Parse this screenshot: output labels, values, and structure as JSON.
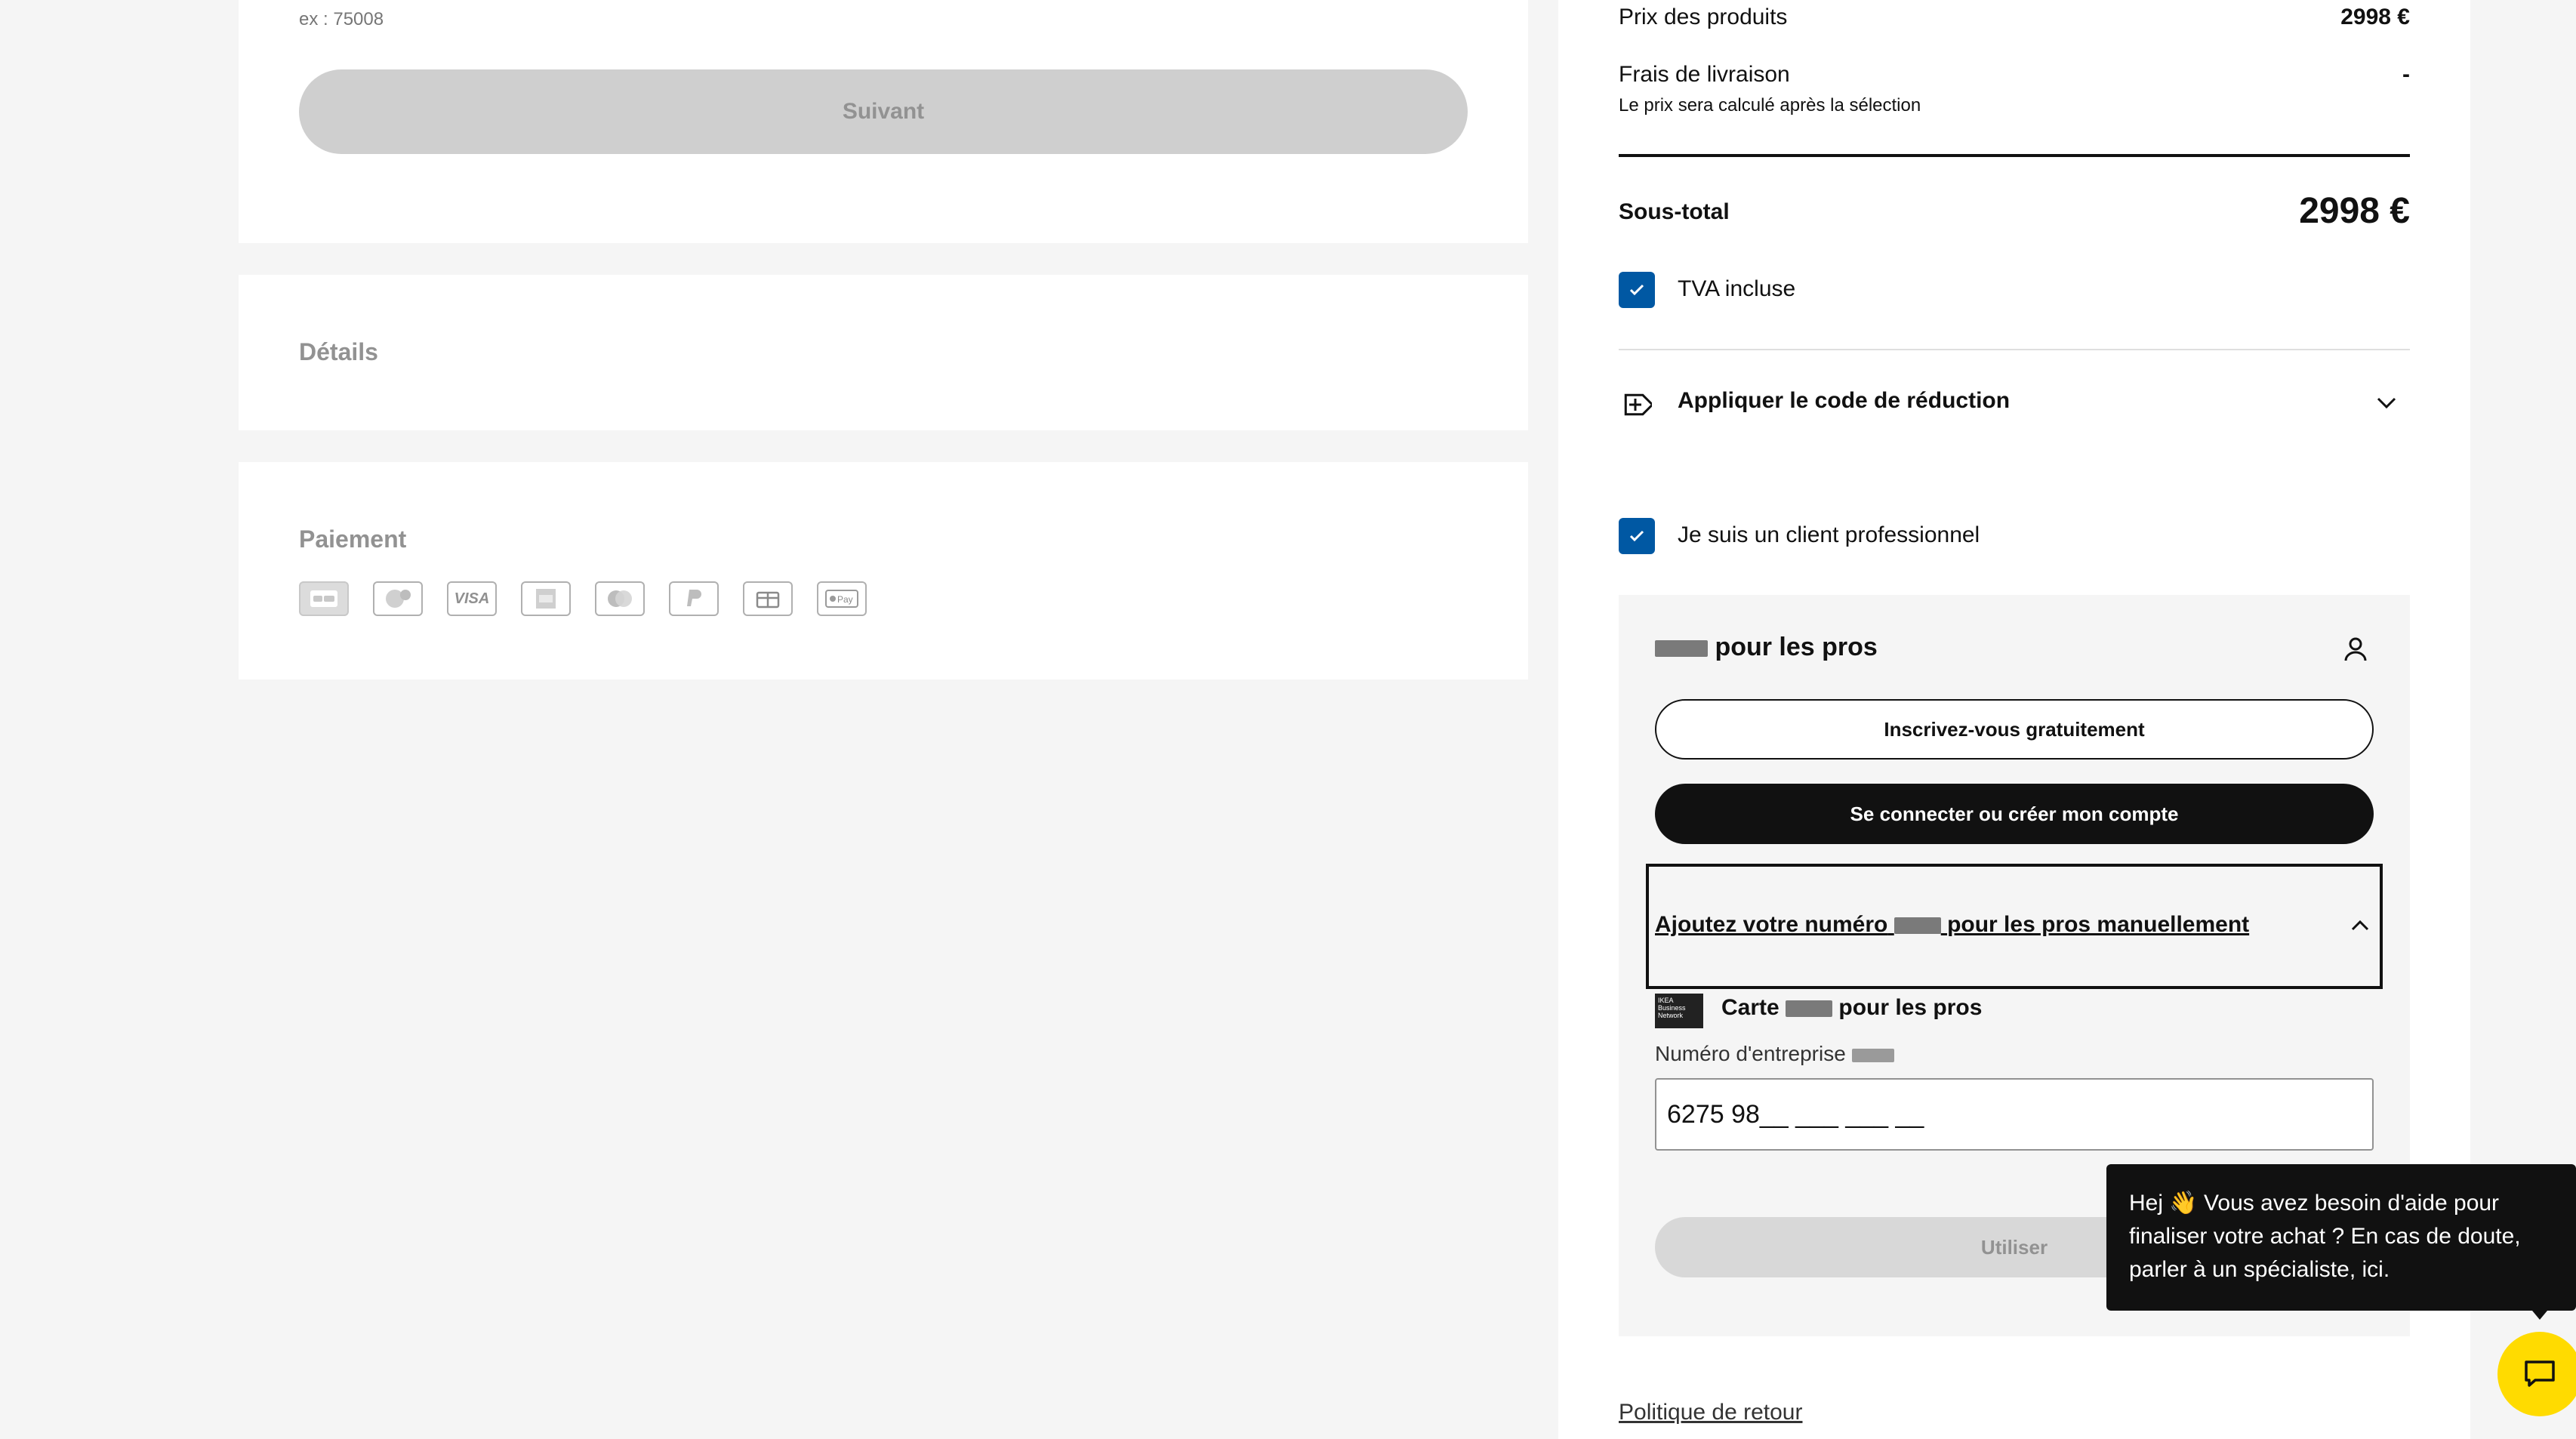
{
  "checkout": {
    "postal_hint": "ex : 75008",
    "next_button": "Suivant",
    "details_title": "Détails",
    "payment_title": "Paiement",
    "payment_icons": [
      "card-icon",
      "giftcard-icon",
      "visa-icon",
      "amex-icon",
      "mastercard-icon",
      "paypal-icon",
      "voucher-icon",
      "applepay-icon"
    ],
    "visa_text": "VISA",
    "applepay_text": "Pay"
  },
  "summary": {
    "products_label": "Prix des produits",
    "products_value": "2998 €",
    "delivery_label": "Frais de livraison",
    "delivery_value": "-",
    "delivery_note": "Le prix sera calculé après la sélection",
    "subtotal_label": "Sous-total",
    "subtotal_value": "2998 €",
    "vat_label": "TVA incluse",
    "discount_label": "Appliquer le code de réduction",
    "pro_client_label": "Je suis un client professionnel"
  },
  "pro": {
    "title_suffix": "pour les pros",
    "register_button": "Inscrivez-vous gratuitement",
    "login_button": "Se connecter ou créer mon compte",
    "manual_prefix": "Ajoutez votre numéro",
    "manual_suffix": "pour les pros manuellement",
    "card_prefix": "Carte",
    "card_suffix": "pour les pros",
    "card_logo_text": "IKEA Business Network",
    "number_label": "Numéro d'entreprise",
    "number_value": "6275 98__ ___ ___ __",
    "use_button": "Utiliser"
  },
  "footer": {
    "return_policy": "Politique de retour"
  },
  "chat": {
    "message": "Hej 👋 Vous avez besoin d'aide pour finaliser votre achat ? En cas de doute, parler à un spécialiste, ici."
  },
  "colors": {
    "accent_blue": "#0058a3",
    "chat_yellow": "#ffdb00"
  }
}
